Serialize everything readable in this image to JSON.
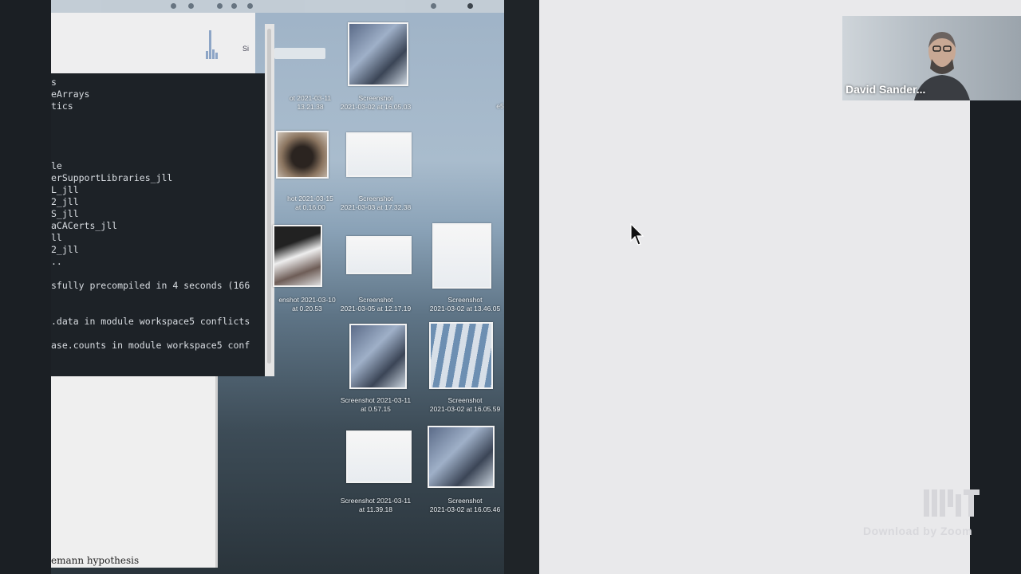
{
  "participant": {
    "name": "David Sander..."
  },
  "watermark": {
    "text": "Download by Zoom"
  },
  "upper_window": {
    "label": "Si"
  },
  "terminal": {
    "lines": [
      "s",
      "eArrays",
      "tics",
      "",
      "",
      "",
      "le",
      "erSupportLibraries_jll",
      "L_jll",
      "2_jll",
      "S_jll",
      "aCACerts_jll",
      "ll",
      "2_jll",
      "..",
      "",
      "sfully precompiled in 4 seconds (166",
      "",
      "",
      ".data in module workspace5 conflicts",
      "",
      "ase.counts in module workspace5 conf"
    ]
  },
  "doc_window": {
    "visible_text": "emann hypothesis"
  },
  "desktop_files": [
    {
      "label1": "ot 2021-03-11",
      "label2": "13.21.38"
    },
    {
      "label1": "Screenshot",
      "label2": "2021-03-02 at 16.05.03"
    },
    {
      "label1": "e5",
      "label2": ""
    },
    {
      "label1": "hot 2021-03-15",
      "label2": "at 0.16.00"
    },
    {
      "label1": "Screenshot",
      "label2": "2021-03-03 at 17.32.38"
    },
    {
      "label1": "enshot 2021-03-10",
      "label2": "at 0.20.53"
    },
    {
      "label1": "Screenshot",
      "label2": "2021-03-05 at 12.17.19"
    },
    {
      "label1": "Screenshot",
      "label2": "2021-03-02 at 13.46.05"
    },
    {
      "label1": "Screenshot 2021-03-11",
      "label2": "at 0.57.15"
    },
    {
      "label1": "Screenshot",
      "label2": "2021-03-02 at 16.05.59"
    },
    {
      "label1": "Screenshot 2021-03-11",
      "label2": "at 11.39.18"
    },
    {
      "label1": "Screenshot",
      "label2": "2021-03-02 at 16.05.46"
    }
  ],
  "icons": {
    "cursor": "mouse-pointer-icon",
    "logo": "mit-logo-icon"
  }
}
